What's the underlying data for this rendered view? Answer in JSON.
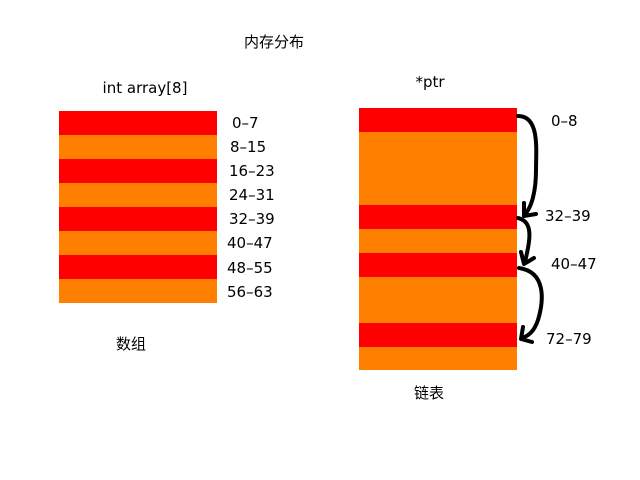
{
  "title": "内存分布",
  "colors": {
    "red": "#FF0000",
    "orange": "#FF8000",
    "arrow": "#000000",
    "background": "#FFFFFF"
  },
  "array_section": {
    "heading": "int array[8]",
    "caption": "数组",
    "blocks": [
      {
        "label": "0–7",
        "color": "red"
      },
      {
        "label": "8–15",
        "color": "orange"
      },
      {
        "label": "16–23",
        "color": "red"
      },
      {
        "label": "24–31",
        "color": "orange"
      },
      {
        "label": "32–39",
        "color": "red"
      },
      {
        "label": "40–47",
        "color": "orange"
      },
      {
        "label": "48–55",
        "color": "red"
      },
      {
        "label": "56–63",
        "color": "orange"
      }
    ]
  },
  "list_section": {
    "heading": "*ptr",
    "caption": "链表",
    "nodes": [
      {
        "label": "0–8"
      },
      {
        "label": "32–39"
      },
      {
        "label": "40–47"
      },
      {
        "label": "72–79"
      }
    ]
  }
}
